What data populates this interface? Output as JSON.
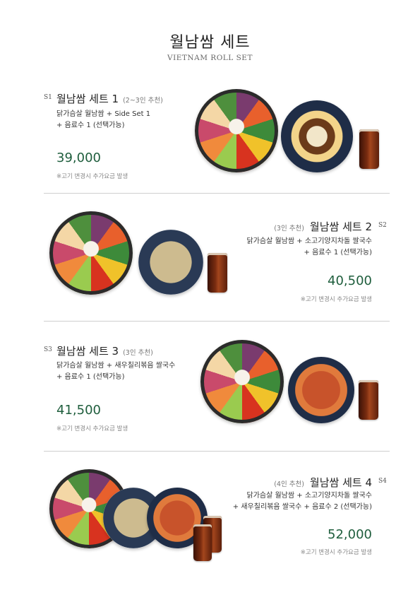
{
  "header": {
    "title": "월남쌈 세트",
    "subtitle": "VIETNAM ROLL SET"
  },
  "sets": [
    {
      "code": "S1",
      "name": "월남쌈 세트 1",
      "recommend": "(2~3인 추천)",
      "desc_line1": "닭가슴살 월남쌈 + Side Set 1",
      "desc_line2": "+ 음료수 1 (선택가능)",
      "price": "39,000",
      "note": "※고기 변경시 추가요금 발생"
    },
    {
      "code": "S2",
      "name": "월남쌈 세트 2",
      "recommend": "(3인 추천)",
      "desc_line1": "닭가슴살 월남쌈 + 소고기양지차돌 쌀국수",
      "desc_line2": "+ 음료수 1 (선택가능)",
      "price": "40,500",
      "note": "※고기 변경시 추가요금 발생"
    },
    {
      "code": "S3",
      "name": "월남쌈 세트 3",
      "recommend": "(3인 추천)",
      "desc_line1": "닭가슴살 월남쌈 + 새우칠리볶음 쌀국수",
      "desc_line2": "+ 음료수 1 (선택가능)",
      "price": "41,500",
      "note": "※고기 변경시 추가요금 발생"
    },
    {
      "code": "S4",
      "name": "월남쌈 세트 4",
      "recommend": "(4인 추천)",
      "desc_line1": "닭가슴살 월남쌈 + 소고기양지차돌 쌀국수",
      "desc_line2": "+ 새우칠리볶음 쌀국수 + 음료수 2 (선택가능)",
      "price": "52,000",
      "note": "※고기 변경시 추가요금 발생"
    }
  ]
}
